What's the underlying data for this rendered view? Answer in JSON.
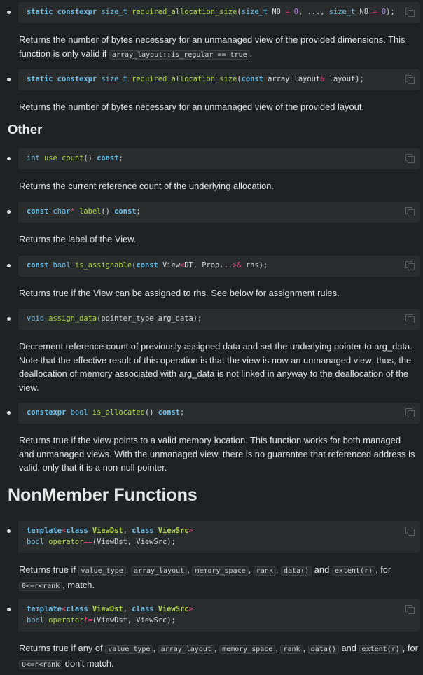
{
  "members": [
    {
      "code": [
        [
          {
            "t": "static constexpr",
            "c": "kw"
          },
          {
            "t": " "
          },
          {
            "t": "size_t",
            "c": "ty"
          },
          {
            "t": " "
          },
          {
            "t": "required_allocation_size",
            "c": "fn"
          },
          {
            "t": "("
          },
          {
            "t": "size_t",
            "c": "ty"
          },
          {
            "t": " N0 "
          },
          {
            "t": "=",
            "c": "op"
          },
          {
            "t": " "
          },
          {
            "t": "0",
            "c": "num"
          },
          {
            "t": ", ..., "
          },
          {
            "t": "size_t",
            "c": "ty"
          },
          {
            "t": " N8 "
          },
          {
            "t": "=",
            "c": "op"
          },
          {
            "t": " "
          },
          {
            "t": "0",
            "c": "num"
          },
          {
            "t": ");"
          }
        ]
      ],
      "desc": [
        {
          "t": "Returns the number of bytes necessary for an unmanaged view of the provided dimensions. This function is only valid if "
        },
        {
          "t": "array_layout::is_regular == true",
          "code": true
        },
        {
          "t": "."
        }
      ]
    },
    {
      "code": [
        [
          {
            "t": "static constexpr",
            "c": "kw"
          },
          {
            "t": " "
          },
          {
            "t": "size_t",
            "c": "ty"
          },
          {
            "t": " "
          },
          {
            "t": "required_allocation_size",
            "c": "fn"
          },
          {
            "t": "("
          },
          {
            "t": "const",
            "c": "kw"
          },
          {
            "t": " array_layout"
          },
          {
            "t": "&",
            "c": "op"
          },
          {
            "t": " layout);"
          }
        ]
      ],
      "desc": [
        {
          "t": "Returns the number of bytes necessary for an unmanaged view of the provided layout."
        }
      ]
    }
  ],
  "other_heading": "Other",
  "other": [
    {
      "code": [
        [
          {
            "t": "int",
            "c": "ty"
          },
          {
            "t": " "
          },
          {
            "t": "use_count",
            "c": "fn"
          },
          {
            "t": "() "
          },
          {
            "t": "const",
            "c": "kw"
          },
          {
            "t": ";"
          }
        ]
      ],
      "desc": [
        {
          "t": "Returns the current reference count of the underlying allocation."
        }
      ]
    },
    {
      "code": [
        [
          {
            "t": "const",
            "c": "kw"
          },
          {
            "t": " "
          },
          {
            "t": "char",
            "c": "ty"
          },
          {
            "t": "*",
            "c": "op"
          },
          {
            "t": " "
          },
          {
            "t": "label",
            "c": "fn"
          },
          {
            "t": "() "
          },
          {
            "t": "const",
            "c": "kw"
          },
          {
            "t": ";"
          }
        ]
      ],
      "desc": [
        {
          "t": "Returns the label of the View."
        }
      ]
    },
    {
      "code": [
        [
          {
            "t": "const",
            "c": "kw"
          },
          {
            "t": " "
          },
          {
            "t": "bool",
            "c": "ty"
          },
          {
            "t": " "
          },
          {
            "t": "is_assignable",
            "c": "fn"
          },
          {
            "t": "("
          },
          {
            "t": "const",
            "c": "kw"
          },
          {
            "t": " View"
          },
          {
            "t": "<",
            "c": "op"
          },
          {
            "t": "DT, Prop..."
          },
          {
            "t": ">&",
            "c": "op"
          },
          {
            "t": " rhs);"
          }
        ]
      ],
      "desc": [
        {
          "t": "Returns true if the View can be assigned to rhs. See below for assignment rules."
        }
      ]
    },
    {
      "code": [
        [
          {
            "t": "void",
            "c": "ty"
          },
          {
            "t": " "
          },
          {
            "t": "assign_data",
            "c": "fn"
          },
          {
            "t": "(pointer_type arg_data);"
          }
        ]
      ],
      "desc": [
        {
          "t": "Decrement reference count of previously assigned data and set the underlying pointer to arg_data. Note that the effective result of this operation is that the view is now an unmanaged view; thus, the deallocation of memory associated with arg_data is not linked in anyway to the deallocation of the view."
        }
      ]
    },
    {
      "code": [
        [
          {
            "t": "constexpr",
            "c": "kw"
          },
          {
            "t": " "
          },
          {
            "t": "bool",
            "c": "ty"
          },
          {
            "t": " "
          },
          {
            "t": "is_allocated",
            "c": "fn"
          },
          {
            "t": "() "
          },
          {
            "t": "const",
            "c": "kw"
          },
          {
            "t": ";"
          }
        ]
      ],
      "desc": [
        {
          "t": "Returns true if the view points to a valid memory location. This function works for both managed and unmanaged views. With the unmanaged view, there is no guarantee that referenced address is valid, only that it is a non-null pointer."
        }
      ]
    }
  ],
  "nonmember_heading": "NonMember Functions",
  "nonmember": [
    {
      "code": [
        [
          {
            "t": "template",
            "c": "kw"
          },
          {
            "t": "<",
            "c": "op"
          },
          {
            "t": "class",
            "c": "kw"
          },
          {
            "t": " "
          },
          {
            "t": "ViewDst",
            "c": "tn"
          },
          {
            "t": ", "
          },
          {
            "t": "class",
            "c": "kw"
          },
          {
            "t": " "
          },
          {
            "t": "ViewSrc",
            "c": "tn"
          },
          {
            "t": ">",
            "c": "op"
          }
        ],
        [
          {
            "t": "bool",
            "c": "ty"
          },
          {
            "t": " "
          },
          {
            "t": "operator",
            "c": "fn"
          },
          {
            "t": "==",
            "c": "op"
          },
          {
            "t": "(ViewDst, ViewSrc);"
          }
        ]
      ],
      "desc": [
        {
          "t": "Returns true if "
        },
        {
          "t": "value_type",
          "code": true
        },
        {
          "t": ", "
        },
        {
          "t": "array_layout",
          "code": true
        },
        {
          "t": ", "
        },
        {
          "t": "memory_space",
          "code": true
        },
        {
          "t": ", "
        },
        {
          "t": "rank",
          "code": true
        },
        {
          "t": ", "
        },
        {
          "t": "data()",
          "code": true
        },
        {
          "t": " and "
        },
        {
          "t": "extent(r)",
          "code": true
        },
        {
          "t": ", for "
        },
        {
          "t": "0<=r<rank",
          "code": true
        },
        {
          "t": ", match."
        }
      ]
    },
    {
      "code": [
        [
          {
            "t": "template",
            "c": "kw"
          },
          {
            "t": "<",
            "c": "op"
          },
          {
            "t": "class",
            "c": "kw"
          },
          {
            "t": " "
          },
          {
            "t": "ViewDst",
            "c": "tn"
          },
          {
            "t": ", "
          },
          {
            "t": "class",
            "c": "kw"
          },
          {
            "t": " "
          },
          {
            "t": "ViewSrc",
            "c": "tn"
          },
          {
            "t": ">",
            "c": "op"
          }
        ],
        [
          {
            "t": "bool",
            "c": "ty"
          },
          {
            "t": " "
          },
          {
            "t": "operator",
            "c": "fn"
          },
          {
            "t": "!=",
            "c": "op"
          },
          {
            "t": "(ViewDst, ViewSrc);"
          }
        ]
      ],
      "desc": [
        {
          "t": "Returns true if any of "
        },
        {
          "t": "value_type",
          "code": true
        },
        {
          "t": ", "
        },
        {
          "t": "array_layout",
          "code": true
        },
        {
          "t": ", "
        },
        {
          "t": "memory_space",
          "code": true
        },
        {
          "t": ", "
        },
        {
          "t": "rank",
          "code": true
        },
        {
          "t": ", "
        },
        {
          "t": "data()",
          "code": true
        },
        {
          "t": " and "
        },
        {
          "t": "extent(r)",
          "code": true
        },
        {
          "t": ", for "
        },
        {
          "t": "0<=r<rank",
          "code": true
        },
        {
          "t": " don't match."
        }
      ]
    }
  ]
}
